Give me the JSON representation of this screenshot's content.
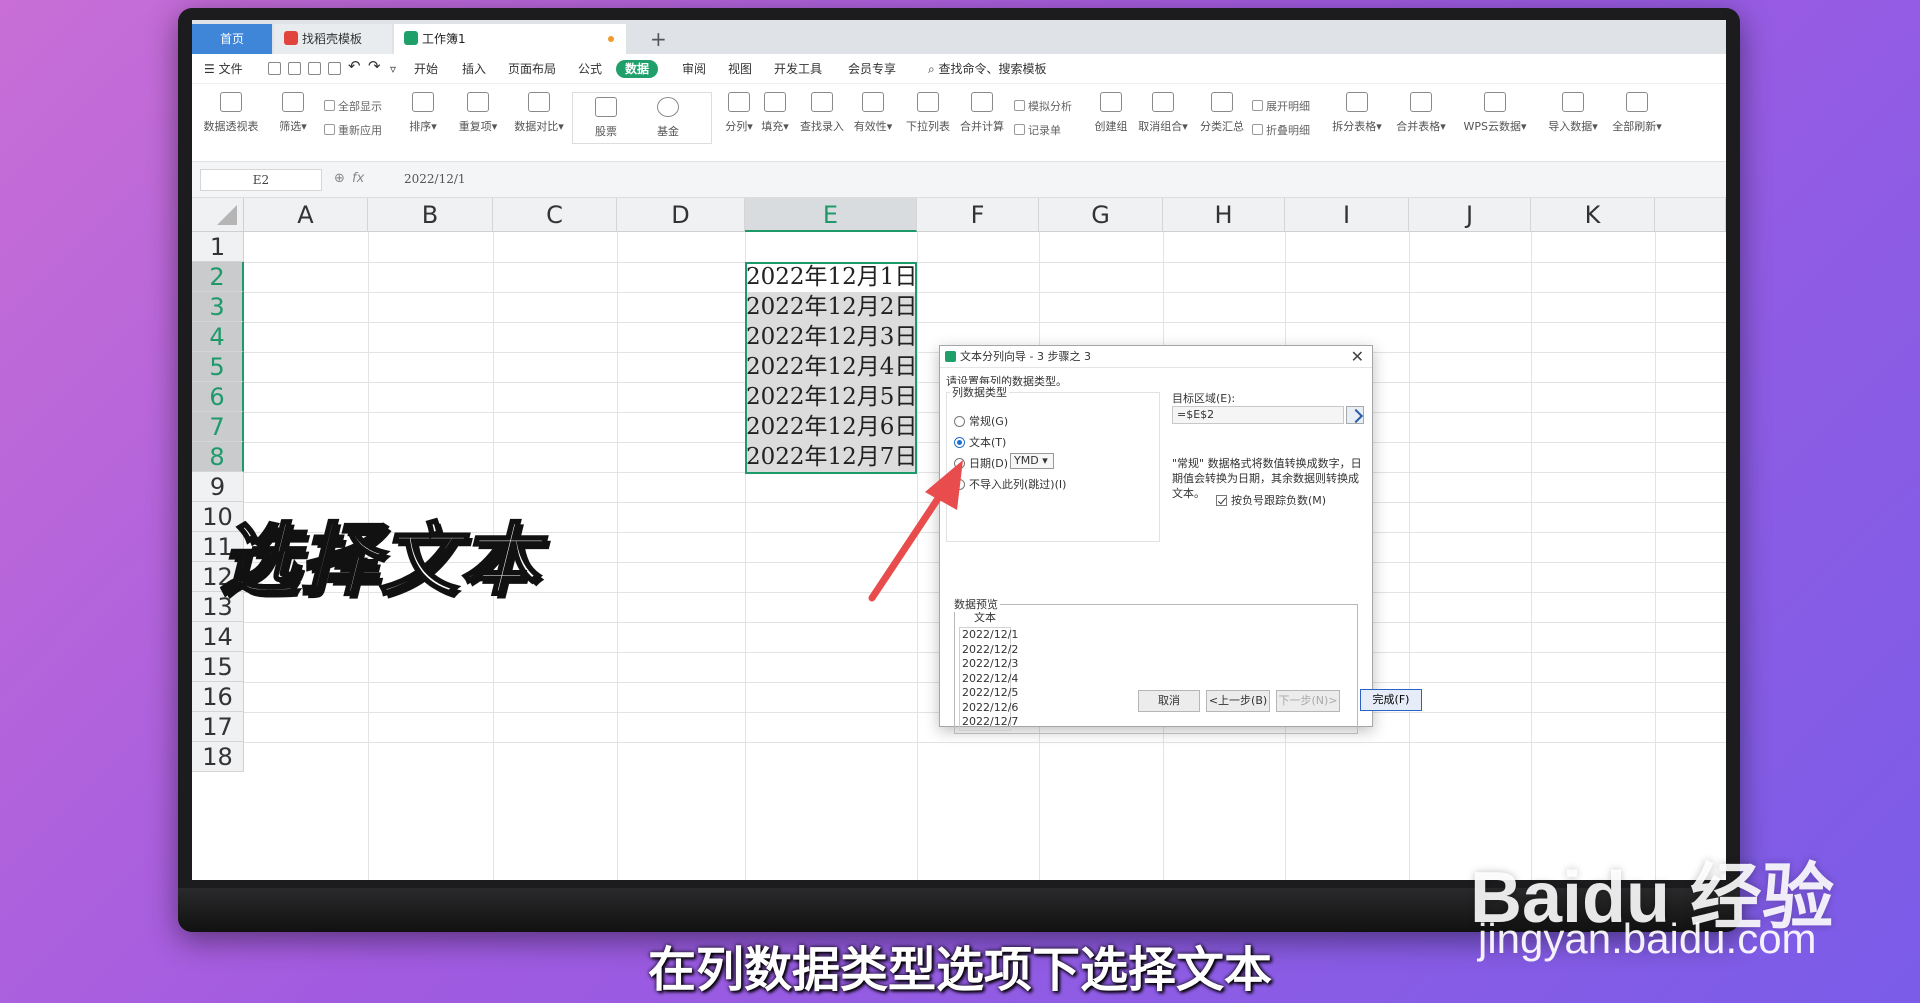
{
  "tabs": {
    "home": "首页",
    "template": "找稻壳模板",
    "workbook": "工作簿1",
    "add": "+"
  },
  "menu": {
    "file": "☰ 文件",
    "items": [
      "开始",
      "插入",
      "页面布局",
      "公式",
      "数据",
      "审阅",
      "视图",
      "开发工具",
      "会员专享"
    ],
    "active": "数据",
    "search": "查找命令、搜索模板"
  },
  "ribbon": {
    "pivot": "数据透视表",
    "filter": "筛选",
    "show_all": "全部显示",
    "reapply": "重新应用",
    "sort": "排序",
    "duplicates": "重复项",
    "compare": "数据对比",
    "stock": "股票",
    "fund": "基金",
    "split_col": "分列",
    "fill": "填充",
    "lookup": "查找录入",
    "validity": "有效性",
    "dropdown": "下拉列表",
    "consolidate": "合并计算",
    "simulate": "模拟分析",
    "record": "记录单",
    "create_group": "创建组",
    "ungroup": "取消组合",
    "subtotal": "分类汇总",
    "expand": "展开明细",
    "collapse": "折叠明细",
    "split_table": "拆分表格",
    "merge_table": "合并表格",
    "wps_cloud": "WPS云数据",
    "import": "导入数据",
    "refresh_all": "全部刷新"
  },
  "formula_bar": {
    "cell_ref": "E2",
    "fx": "fx",
    "value": "2022/12/1"
  },
  "grid": {
    "columns": [
      "A",
      "B",
      "C",
      "D",
      "E",
      "F",
      "G",
      "H",
      "I",
      "J",
      "K"
    ],
    "selected_column": "E",
    "rows": [
      "1",
      "2",
      "3",
      "4",
      "5",
      "6",
      "7",
      "8",
      "9",
      "10",
      "11",
      "12",
      "13",
      "14",
      "15",
      "16",
      "17",
      "18"
    ],
    "selected_rows": [
      "2",
      "3",
      "4",
      "5",
      "6",
      "7",
      "8"
    ],
    "e_values": [
      "2022年12月1日",
      "2022年12月2日",
      "2022年12月3日",
      "2022年12月4日",
      "2022年12月5日",
      "2022年12月6日",
      "2022年12月7日"
    ]
  },
  "dialog": {
    "title": "文本分列向导 - 3 步骤之 3",
    "close": "✕",
    "instruction": "请设置每列的数据类型。",
    "group_title": "列数据类型",
    "options": [
      "常规(G)",
      "文本(T)",
      "日期(D)",
      "不导入此列(跳过)(I)"
    ],
    "selected_option": "文本(T)",
    "date_format": "YMD",
    "target_label": "目标区域(E):",
    "target_value": "=$E$2",
    "description": "\"常规\" 数据格式将数值转换成数字，日期值会转换为日期，其余数据则转换成文本。",
    "checkbox": "按负号跟踪负数(M)",
    "preview_title": "数据预览",
    "preview_header": "文本",
    "preview_rows": [
      "2022/12/1",
      "2022/12/2",
      "2022/12/3",
      "2022/12/4",
      "2022/12/5",
      "2022/12/6",
      "2022/12/7"
    ],
    "buttons": {
      "cancel": "取消",
      "back": "<上一步(B)",
      "next": "下一步(N)>",
      "finish": "完成(F)"
    }
  },
  "overlay": {
    "callout": "选择文本",
    "subtitle": "在列数据类型选项下选择文本",
    "watermark_brand": "Baidu 经验",
    "watermark_url": "jingyan.baidu.com"
  },
  "colors": {
    "accent": "#1fa06b",
    "selection": "#1e9a6a",
    "arrow": "#e84c4c",
    "home_tab": "#3f86d9"
  }
}
